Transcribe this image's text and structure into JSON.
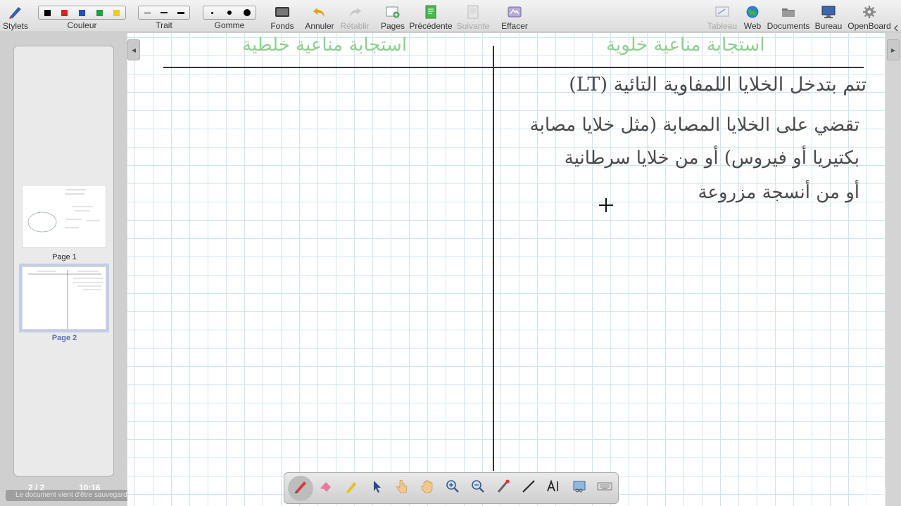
{
  "toolbar": {
    "stylets": "Stylets",
    "couleur": "Couleur",
    "trait": "Trait",
    "gomme": "Gomme",
    "fonds": "Fonds",
    "annuler": "Annuler",
    "retablir": "Rétablir",
    "pages": "Pages",
    "precedente": "Précédente",
    "suivante": "Suivante",
    "effacer": "Effacer",
    "tableau": "Tableau",
    "web": "Web",
    "documents": "Documents",
    "bureau": "Bureau",
    "openboard": "OpenBoard"
  },
  "colors": [
    "#000000",
    "#e02020",
    "#2050c0",
    "#20a040",
    "#e8d020"
  ],
  "pages": {
    "items": [
      {
        "label": "Page 1"
      },
      {
        "label": "Page 2"
      }
    ],
    "counter": "2 / 2",
    "clock": "10:16",
    "status": "Le document vient d'être sauvegardé..."
  },
  "board": {
    "left_heading": "استجابة مناعية خلطية",
    "right_heading": "استجابة مناعية خلوية",
    "lines": [
      "تتم بتدخل الخلايا اللمفاوية التائية (LT)",
      "تقضي على الخلايا المصابة (مثل خلايا مصابة",
      "بكتيريا أو فيروس) أو من خلايا سرطانية",
      "أو من أنسجة مزروعة"
    ]
  },
  "watermark": "InShOt"
}
